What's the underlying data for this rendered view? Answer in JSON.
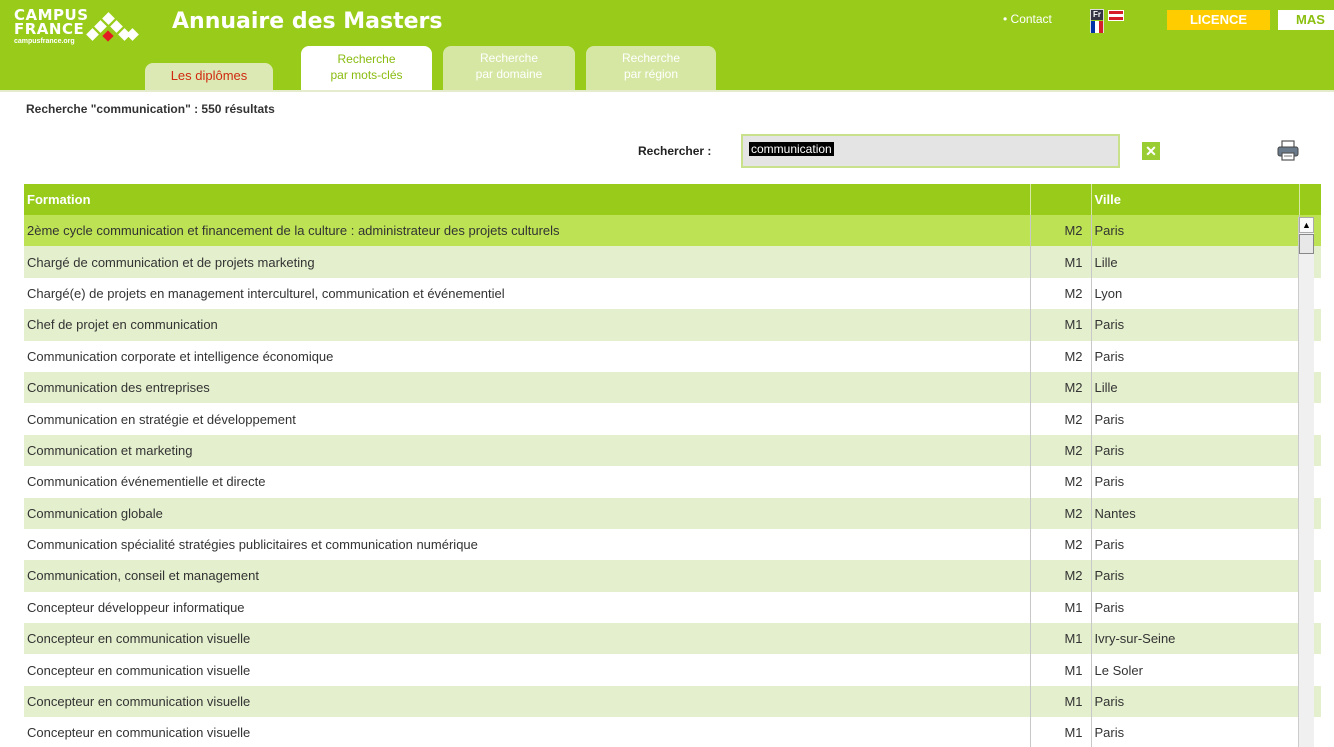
{
  "header": {
    "logo_text_1": "CAMPUS",
    "logo_text_2": "FRANCE",
    "logo_url": "campusfrance.org",
    "title": "Annuaire des Masters",
    "contact": "• Contact",
    "lang_fr": "Fr",
    "licence": "LICENCE",
    "master": "MAS"
  },
  "tabs": {
    "diplomes": "Les diplômes",
    "mots_line1": "Recherche",
    "mots_line2": "par mots-clés",
    "domaine_line1": "Recherche",
    "domaine_line2": "par domaine",
    "region_line1": "Recherche",
    "region_line2": "par région"
  },
  "search": {
    "result_count": "Recherche \"communication\" : 550 résultats",
    "label": "Rechercher :",
    "value": "communication",
    "clear": "✕"
  },
  "table": {
    "headers": {
      "formation": "Formation",
      "level": "",
      "ville": "Ville"
    },
    "rows": [
      {
        "formation": "2ème cycle communication et financement de la culture : administrateur des projets culturels",
        "level": "M2",
        "ville": "Paris"
      },
      {
        "formation": "Chargé de communication et de projets marketing",
        "level": "M1",
        "ville": "Lille"
      },
      {
        "formation": "Chargé(e) de projets en management interculturel, communication et événementiel",
        "level": "M2",
        "ville": "Lyon"
      },
      {
        "formation": "Chef de projet en communication",
        "level": "M1",
        "ville": "Paris"
      },
      {
        "formation": "Communication corporate et intelligence économique",
        "level": "M2",
        "ville": "Paris"
      },
      {
        "formation": "Communication des entreprises",
        "level": "M2",
        "ville": "Lille"
      },
      {
        "formation": "Communication en stratégie et développement",
        "level": "M2",
        "ville": "Paris"
      },
      {
        "formation": "Communication et marketing",
        "level": "M2",
        "ville": "Paris"
      },
      {
        "formation": "Communication événementielle et directe",
        "level": "M2",
        "ville": "Paris"
      },
      {
        "formation": "Communication globale",
        "level": "M2",
        "ville": "Nantes"
      },
      {
        "formation": "Communication spécialité stratégies publicitaires et communication numérique",
        "level": "M2",
        "ville": "Paris"
      },
      {
        "formation": "Communication, conseil et management",
        "level": "M2",
        "ville": "Paris"
      },
      {
        "formation": "Concepteur développeur informatique",
        "level": "M1",
        "ville": "Paris"
      },
      {
        "formation": "Concepteur en communication visuelle",
        "level": "M1",
        "ville": "Ivry-sur-Seine"
      },
      {
        "formation": "Concepteur en communication visuelle",
        "level": "M1",
        "ville": "Le Soler"
      },
      {
        "formation": "Concepteur en communication visuelle",
        "level": "M1",
        "ville": "Paris"
      },
      {
        "formation": "Concepteur en communication visuelle",
        "level": "M1",
        "ville": "Paris"
      }
    ]
  },
  "colors": {
    "brand_green": "#99cc1a",
    "row_alt": "#e4efcd",
    "row_selected": "#bde354",
    "licence_yellow": "#ffcc00"
  }
}
